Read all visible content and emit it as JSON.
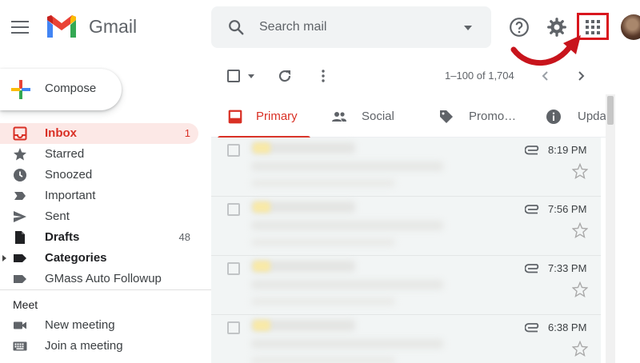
{
  "app": {
    "name": "Gmail",
    "logo_icon": "gmail-m-logo",
    "colors": {
      "red": "#d93025",
      "highlight_red": "#d9161e",
      "active_bg": "#fce8e6"
    }
  },
  "header": {
    "search_placeholder": "Search mail",
    "icons": [
      "menu-icon",
      "search-icon",
      "search-options-icon",
      "help-icon",
      "settings-gear-icon",
      "apps-grid-icon",
      "avatar"
    ]
  },
  "sidebar": {
    "compose_label": "Compose",
    "items": [
      {
        "label": "Inbox",
        "count": "1",
        "icon": "inbox-icon"
      },
      {
        "label": "Starred",
        "count": "",
        "icon": "star-icon"
      },
      {
        "label": "Snoozed",
        "count": "",
        "icon": "clock-icon"
      },
      {
        "label": "Important",
        "count": "",
        "icon": "important-icon"
      },
      {
        "label": "Sent",
        "count": "",
        "icon": "send-icon"
      },
      {
        "label": "Drafts",
        "count": "48",
        "icon": "draft-icon"
      },
      {
        "label": "Categories",
        "count": "",
        "icon": "label-icon"
      },
      {
        "label": "GMass Auto Followup",
        "count": "",
        "icon": "label-icon"
      }
    ],
    "meet": {
      "title": "Meet",
      "items": [
        {
          "label": "New meeting",
          "icon": "video-camera-icon"
        },
        {
          "label": "Join a meeting",
          "icon": "keyboard-icon"
        }
      ]
    }
  },
  "toolbar": {
    "pagination": "1–100 of 1,704"
  },
  "tabs": [
    {
      "label": "Primary",
      "icon": "inbox-icon",
      "active": true
    },
    {
      "label": "Social",
      "icon": "people-icon",
      "active": false
    },
    {
      "label": "Promo…",
      "icon": "tag-icon",
      "active": false
    },
    {
      "label": "Upda",
      "icon": "info-icon",
      "active": false
    }
  ],
  "emails": [
    {
      "time": "8:19 PM",
      "attachment": true
    },
    {
      "time": "7:56 PM",
      "attachment": true
    },
    {
      "time": "7:33 PM",
      "attachment": true
    },
    {
      "time": "6:38 PM",
      "attachment": true
    }
  ]
}
